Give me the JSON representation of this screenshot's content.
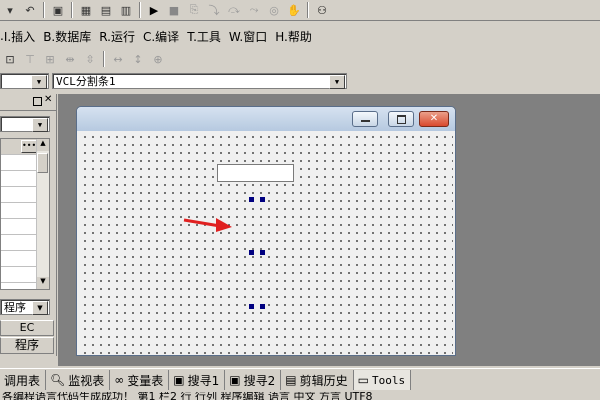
{
  "menu": {
    "items": [
      "I.插入",
      "B.数据库",
      "R.运行",
      "C.编译",
      "T.工具",
      "W.窗口",
      "H.帮助"
    ],
    "partial_left": "."
  },
  "toolbar": {
    "icons": [
      "find-icon",
      "form-icon",
      "layout-icon",
      "split-icon",
      "run-icon",
      "stop-icon",
      "step-icon",
      "trace-icon",
      "watch-icon",
      "hand-icon",
      "binoculars-icon"
    ]
  },
  "component_combo": {
    "value": "VCL分割条1"
  },
  "left_panel": {
    "combo_value": "",
    "lower_combo_value": "程序",
    "rows": 8,
    "tab_a": "EC",
    "tab_b": "程序"
  },
  "form": {
    "window_controls": [
      "minimize",
      "maximize",
      "close"
    ]
  },
  "bottom_tabs": [
    {
      "label": "调用表",
      "icon": "call-icon"
    },
    {
      "label": "监视表",
      "icon": "magnifier-icon"
    },
    {
      "label": "变量表",
      "icon": "variables-icon"
    },
    {
      "label": "搜寻1",
      "icon": "search1-icon"
    },
    {
      "label": "搜寻2",
      "icon": "search2-icon"
    },
    {
      "label": "剪辑历史",
      "icon": "clipboard-icon"
    },
    {
      "label": "Tools",
      "icon": "window-icon"
    }
  ],
  "status": {
    "text": "各编程语言代码生成成功！ 第1 栏2 行 行列 程序编辑  语言 中文  方言 UTF8"
  },
  "colors": {
    "arrow": "#e02020",
    "handle": "#000080",
    "close": "#d9492e",
    "titlebar": "#b6c9e0"
  }
}
